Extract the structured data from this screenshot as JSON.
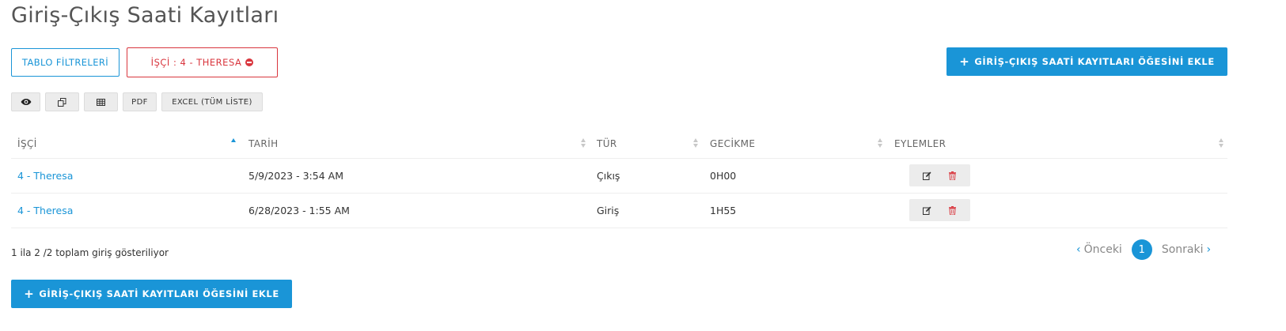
{
  "page": {
    "title": "Giriş-Çıkış Saati Kayıtları"
  },
  "filters": {
    "table_filters_label": "TABLO FİLTRELERİ",
    "active_filter_label": "İŞÇİ : 4 - THERESA"
  },
  "actions": {
    "add_label": "GİRİŞ-ÇIKIŞ SAATİ KAYITLARI ÖĞESİNİ EKLE"
  },
  "export": {
    "pdf_label": "PDF",
    "excel_label": "EXCEL (TÜM LİSTE)",
    "icons": [
      "eye-icon",
      "copy-icon",
      "table-icon"
    ]
  },
  "table": {
    "columns": [
      "İŞÇİ",
      "TARİH",
      "TÜR",
      "GECİKME",
      "EYLEMLER"
    ],
    "sorted_column": "İŞÇİ",
    "sort_direction": "ascending",
    "rows": [
      {
        "worker": "4 - Theresa",
        "date": "5/9/2023 - 3:54 AM",
        "type": "Çıkış",
        "delay": "0H00"
      },
      {
        "worker": "4 - Theresa",
        "date": "6/28/2023 - 1:55 AM",
        "type": "Giriş",
        "delay": "1H55"
      }
    ]
  },
  "footer": {
    "info_text": "1 ila 2 /2 toplam giriş gösteriliyor"
  },
  "pagination": {
    "prev_label": "Önceki",
    "next_label": "Sonraki",
    "current_page": "1"
  },
  "colors": {
    "primary": "#1a95d7",
    "danger": "#d9363e"
  }
}
